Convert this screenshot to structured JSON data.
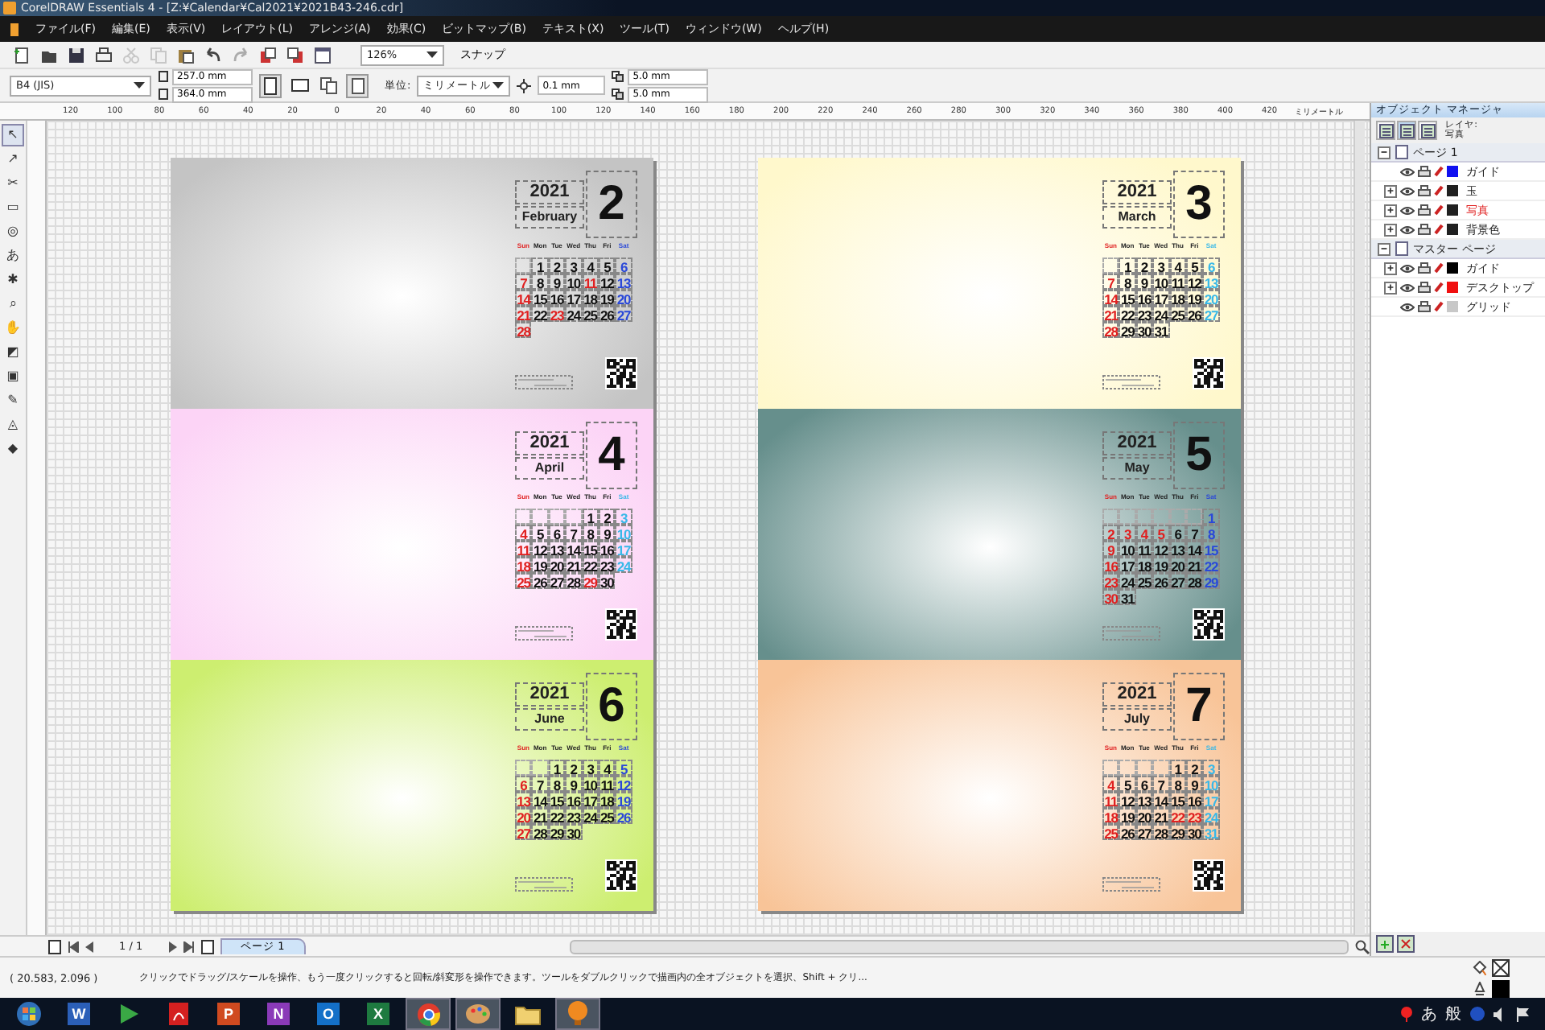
{
  "window": {
    "title": "CorelDRAW Essentials 4 - [Z:¥Calendar¥Cal2021¥2021B43-246.cdr]"
  },
  "menu": [
    "ファイル(F)",
    "編集(E)",
    "表示(V)",
    "レイアウト(L)",
    "アレンジ(A)",
    "効果(C)",
    "ビットマップ(B)",
    "テキスト(X)",
    "ツール(T)",
    "ウィンドウ(W)",
    "ヘルプ(H)"
  ],
  "toolbar": {
    "buttons": [
      {
        "kind": "new",
        "disabled": false
      },
      {
        "kind": "open",
        "disabled": false
      },
      {
        "kind": "save",
        "disabled": false
      },
      {
        "kind": "print",
        "disabled": false
      },
      {
        "kind": "cut",
        "disabled": true
      },
      {
        "kind": "copy",
        "disabled": true
      },
      {
        "kind": "paste",
        "disabled": false
      },
      {
        "kind": "undo",
        "disabled": false
      },
      {
        "kind": "redo",
        "disabled": true
      },
      {
        "kind": "import",
        "disabled": false
      },
      {
        "kind": "export",
        "disabled": false
      },
      {
        "kind": "launcher",
        "disabled": false
      }
    ],
    "zoom": "126%",
    "snap": "スナップ"
  },
  "property_bar": {
    "paper": "B4 (JIS)",
    "width": "257.0 mm",
    "height": "364.0 mm",
    "unit_label": "単位:",
    "unit": "ミリメートル",
    "nudge": "0.1 mm",
    "dup_x": "5.0 mm",
    "dup_y": "5.0 mm"
  },
  "ruler": {
    "labels": [
      "120",
      "100",
      "80",
      "60",
      "40",
      "20",
      "0",
      "20",
      "40",
      "60",
      "80",
      "100",
      "120",
      "140",
      "160",
      "180",
      "200",
      "220",
      "240",
      "260",
      "280",
      "300",
      "320",
      "340",
      "360",
      "380",
      "400",
      "420"
    ],
    "unit": "ミリメートル"
  },
  "toolbox": [
    "↖",
    "↗",
    "✂",
    "▭",
    "◎",
    "あ",
    "✱",
    "⌕",
    "✋",
    "◩",
    "▣",
    "✎",
    "◬",
    "◆"
  ],
  "pages": [
    {
      "calendars": [
        {
          "color": "#c4c4c4",
          "saturday": {
            "color": "#2a48d8"
          },
          "year": "2021",
          "month_name": "February",
          "month": "2",
          "weekdays": [
            "Sun",
            "Mon",
            "Tue",
            "Wed",
            "Thu",
            "Fri",
            "Sat"
          ],
          "weeks": [
            [
              {
                "kind": "blank"
              },
              "1",
              "2",
              "3",
              "4",
              "5",
              "6"
            ],
            [
              "7",
              "8",
              "9",
              "10",
              {
                "d": "11",
                "kind": "holiday"
              },
              "12",
              "13"
            ],
            [
              "14",
              "15",
              "16",
              "17",
              "18",
              "19",
              "20"
            ],
            [
              "21",
              "22",
              {
                "d": "23",
                "kind": "holiday"
              },
              "24",
              "25",
              "26",
              "27"
            ],
            [
              "28"
            ]
          ]
        },
        {
          "color": "#fcd4f6",
          "saturday": {
            "color": "#38b8e8"
          },
          "year": "2021",
          "month_name": "April",
          "month": "4",
          "weekdays": [
            "Sun",
            "Mon",
            "Tue",
            "Wed",
            "Thu",
            "Fri",
            "Sat"
          ],
          "weeks": [
            [
              {
                "kind": "blank"
              },
              {
                "kind": "blank"
              },
              {
                "kind": "blank"
              },
              {
                "kind": "blank"
              },
              "1",
              "2",
              "3"
            ],
            [
              "4",
              "5",
              "6",
              "7",
              "8",
              "9",
              "10"
            ],
            [
              "11",
              "12",
              "13",
              "14",
              "15",
              "16",
              "17"
            ],
            [
              "18",
              "19",
              "20",
              "21",
              "22",
              "23",
              "24"
            ],
            [
              "25",
              "26",
              "27",
              "28",
              {
                "d": "29",
                "kind": "holiday"
              },
              "30"
            ]
          ]
        },
        {
          "color": "#cdee70",
          "saturday": {
            "color": "#2a48d8"
          },
          "year": "2021",
          "month_name": "June",
          "month": "6",
          "weekdays": [
            "Sun",
            "Mon",
            "Tue",
            "Wed",
            "Thu",
            "Fri",
            "Sat"
          ],
          "weeks": [
            [
              {
                "kind": "blank"
              },
              {
                "kind": "blank"
              },
              "1",
              "2",
              "3",
              "4",
              "5"
            ],
            [
              "6",
              "7",
              "8",
              "9",
              "10",
              "11",
              "12"
            ],
            [
              "13",
              "14",
              "15",
              "16",
              "17",
              "18",
              "19"
            ],
            [
              "20",
              "21",
              "22",
              "23",
              "24",
              "25",
              "26"
            ],
            [
              "27",
              "28",
              "29",
              "30"
            ]
          ]
        }
      ]
    },
    {
      "calendars": [
        {
          "color": "#fff8cc",
          "saturday": {
            "color": "#38b8e8"
          },
          "year": "2021",
          "month_name": "March",
          "month": "3",
          "weekdays": [
            "Sun",
            "Mon",
            "Tue",
            "Wed",
            "Thu",
            "Fri",
            "Sat"
          ],
          "weeks": [
            [
              {
                "kind": "blank"
              },
              "1",
              "2",
              "3",
              "4",
              "5",
              "6"
            ],
            [
              "7",
              "8",
              "9",
              "10",
              "11",
              "12",
              "13"
            ],
            [
              "14",
              "15",
              "16",
              "17",
              "18",
              "19",
              "20"
            ],
            [
              "21",
              "22",
              "23",
              "24",
              "25",
              "26",
              "27"
            ],
            [
              "28",
              "29",
              "30",
              "31"
            ]
          ]
        },
        {
          "color": "#668f8c",
          "saturday": {
            "color": "#2a48d8"
          },
          "year": "2021",
          "month_name": "May",
          "month": "5",
          "weekdays": [
            "Sun",
            "Mon",
            "Tue",
            "Wed",
            "Thu",
            "Fri",
            "Sat"
          ],
          "weeks": [
            [
              {
                "kind": "blank"
              },
              {
                "kind": "blank"
              },
              {
                "kind": "blank"
              },
              {
                "kind": "blank"
              },
              {
                "kind": "blank"
              },
              {
                "kind": "blank"
              },
              "1"
            ],
            [
              "2",
              {
                "d": "3",
                "kind": "holiday"
              },
              {
                "d": "4",
                "kind": "holiday"
              },
              {
                "d": "5",
                "kind": "holiday"
              },
              "6",
              "7",
              "8"
            ],
            [
              "9",
              "10",
              "11",
              "12",
              "13",
              "14",
              "15"
            ],
            [
              "16",
              "17",
              "18",
              "19",
              "20",
              "21",
              "22"
            ],
            [
              "23",
              "24",
              "25",
              "26",
              "27",
              "28",
              "29"
            ],
            [
              "30",
              "31"
            ]
          ]
        },
        {
          "color": "#f8c498",
          "saturday": {
            "color": "#38b8e8"
          },
          "year": "2021",
          "month_name": "July",
          "month": "7",
          "weekdays": [
            "Sun",
            "Mon",
            "Tue",
            "Wed",
            "Thu",
            "Fri",
            "Sat"
          ],
          "weeks": [
            [
              {
                "kind": "blank"
              },
              {
                "kind": "blank"
              },
              {
                "kind": "blank"
              },
              {
                "kind": "blank"
              },
              "1",
              "2",
              "3"
            ],
            [
              "4",
              "5",
              "6",
              "7",
              "8",
              "9",
              "10"
            ],
            [
              "11",
              "12",
              "13",
              "14",
              "15",
              "16",
              "17"
            ],
            [
              "18",
              "19",
              "20",
              "21",
              {
                "d": "22",
                "kind": "holiday"
              },
              {
                "d": "23",
                "kind": "holiday"
              },
              "24"
            ],
            [
              "25",
              "26",
              "27",
              "28",
              "29",
              "30",
              "31"
            ]
          ]
        }
      ]
    }
  ],
  "page_nav": {
    "counter": "1 / 1",
    "tabs": [
      {
        "label": "ページ 1",
        "selected": true
      }
    ]
  },
  "object_manager": {
    "title": "オブジェクト マネージャ",
    "layer_label": "レイヤ:",
    "layer": "写真",
    "pages": [
      {
        "label": "ページ 1",
        "expanded": true,
        "layers": [
          {
            "label": "ガイド",
            "color": "#1010f0",
            "selected": false
          },
          {
            "label": "玉",
            "color": "#202020",
            "selected": false,
            "expanded": false
          },
          {
            "label": "写真",
            "color": "#202020",
            "selected": true,
            "expanded": false
          },
          {
            "label": "背景色",
            "color": "#202020",
            "selected": false,
            "expanded": false
          }
        ]
      },
      {
        "label": "マスター ページ",
        "expanded": true,
        "layers": [
          {
            "label": "ガイド",
            "color": "#000000",
            "selected": false,
            "expanded": false
          },
          {
            "label": "デスクトップ",
            "color": "#f01010",
            "selected": false,
            "expanded": false
          },
          {
            "label": "グリッド",
            "color": "#c8c8c8",
            "selected": false
          }
        ]
      }
    ]
  },
  "status_bar": {
    "coords": "( 20.583, 2.096 )",
    "message": "クリックでドラッグ/スケールを操作、もう一度クリックすると回転/斜変形を操作できます。ツールをダブルクリックで描画内の全オブジェクトを選択、Shift + クリ..."
  },
  "taskbar": {
    "items": [
      {
        "kind": "start",
        "active": false
      },
      {
        "kind": "letter",
        "letter": "W",
        "color": "#2b5fb8",
        "active": false
      },
      {
        "kind": "triangle",
        "color": "#3aa845",
        "active": false
      },
      {
        "kind": "pdf",
        "color": "#d42020",
        "active": false
      },
      {
        "kind": "letter",
        "letter": "P",
        "color": "#d04a20",
        "active": false
      },
      {
        "kind": "letter",
        "letter": "N",
        "color": "#8a3ab8",
        "active": false
      },
      {
        "kind": "letter",
        "letter": "O",
        "color": "#1470c8",
        "active": false
      },
      {
        "kind": "letter",
        "letter": "X",
        "color": "#1e7a40",
        "active": false
      },
      {
        "kind": "chrome",
        "active": true
      },
      {
        "kind": "palette",
        "active": true
      },
      {
        "kind": "folder",
        "active": false
      },
      {
        "kind": "corel",
        "color": "#f08a20",
        "active": true
      }
    ],
    "tray": [
      "あ",
      "般"
    ]
  }
}
